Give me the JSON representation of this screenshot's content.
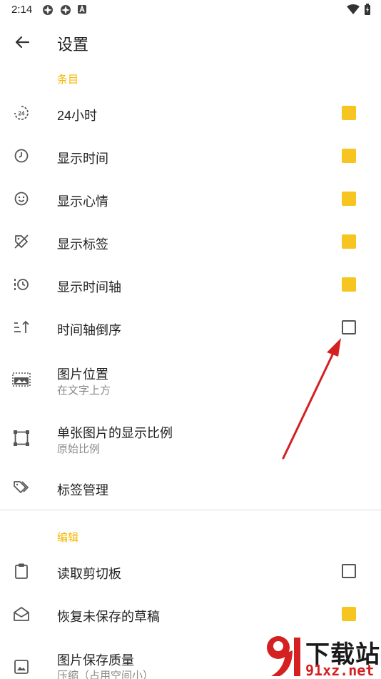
{
  "status_bar": {
    "time": "2:14"
  },
  "app_bar": {
    "title": "设置"
  },
  "sections": [
    {
      "header": "条目"
    },
    {
      "header": "编辑"
    }
  ],
  "rows": [
    {
      "icon": "clock-24-icon",
      "label": "24小时",
      "checked": true
    },
    {
      "icon": "clock-icon",
      "label": "显示时间",
      "checked": true
    },
    {
      "icon": "smiley-icon",
      "label": "显示心情",
      "checked": true
    },
    {
      "icon": "tag-off-icon",
      "label": "显示标签",
      "checked": true
    },
    {
      "icon": "timeline-clock-icon",
      "label": "显示时间轴",
      "checked": true
    },
    {
      "icon": "sort-ascending-icon",
      "label": "时间轴倒序",
      "checked": false
    },
    {
      "icon": "image-position-icon",
      "label": "图片位置",
      "subtitle": "在文字上方"
    },
    {
      "icon": "crop-frame-icon",
      "label": "单张图片的显示比例",
      "subtitle": "原始比例"
    },
    {
      "icon": "tags-icon",
      "label": "标签管理"
    },
    {
      "icon": "clipboard-icon",
      "label": "读取剪切板",
      "checked": false
    },
    {
      "icon": "envelope-open-icon",
      "label": "恢复未保存的草稿",
      "checked": true
    },
    {
      "icon": "image-icon",
      "label": "图片保存质量",
      "subtitle": "压缩（占用空间小）"
    }
  ],
  "watermark": {
    "text": "下载站",
    "url": "91xz.net"
  },
  "colors": {
    "accent": "#f7c51f",
    "section_header": "#f5b800",
    "annotation_arrow": "#d42020"
  }
}
